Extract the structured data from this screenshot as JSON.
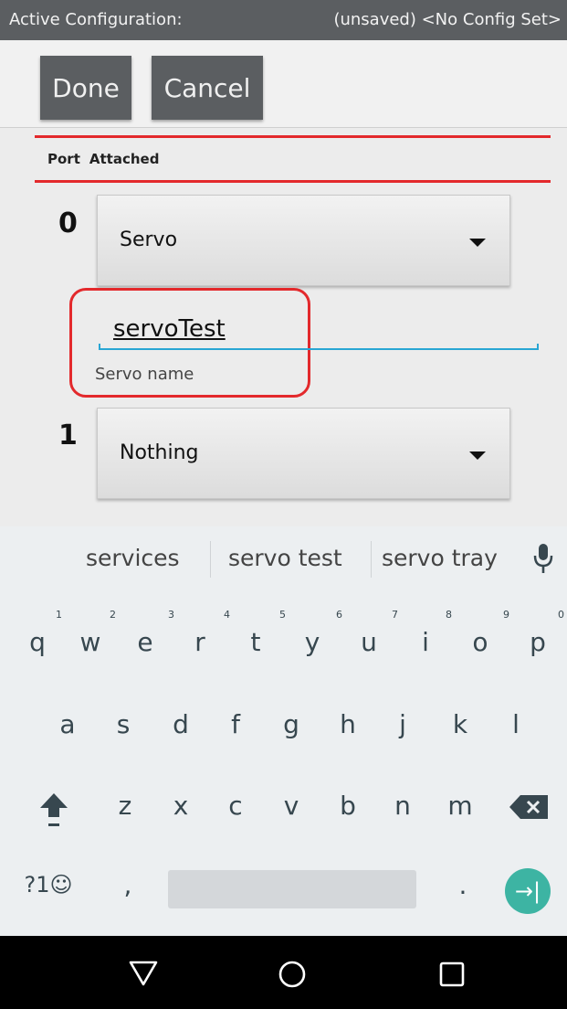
{
  "status": {
    "left": "Active Configuration:",
    "right": "(unsaved) <No Config Set>"
  },
  "toolbar": {
    "done_label": "Done",
    "cancel_label": "Cancel"
  },
  "header": {
    "port": "Port",
    "attached": "Attached"
  },
  "ports": [
    {
      "port": "0",
      "device": "Servo"
    },
    {
      "port": "1",
      "device": "Nothing"
    }
  ],
  "servo_name": {
    "value": "servoTest",
    "label": "Servo name"
  },
  "suggestions": [
    "services",
    "servo test",
    "servo tray"
  ],
  "keyboard": {
    "row1": [
      "q",
      "w",
      "e",
      "r",
      "t",
      "y",
      "u",
      "i",
      "o",
      "p"
    ],
    "row1_hints": [
      "1",
      "2",
      "3",
      "4",
      "5",
      "6",
      "7",
      "8",
      "9",
      "0"
    ],
    "row2": [
      "a",
      "s",
      "d",
      "f",
      "g",
      "h",
      "j",
      "k",
      "l"
    ],
    "row3": [
      "z",
      "x",
      "c",
      "v",
      "b",
      "n",
      "m"
    ],
    "symbols": "?1☺",
    "comma": ",",
    "period": ".",
    "enter_glyph": "→|"
  },
  "colors": {
    "accent_red": "#e3292c",
    "field_blue": "#29a6d4",
    "enter_teal": "#3db4a3"
  },
  "icons": {
    "mic": "mic-icon",
    "shift": "shift-icon",
    "backspace": "backspace-icon",
    "back": "nav-back-icon",
    "home": "nav-home-icon",
    "recents": "nav-recents-icon"
  }
}
